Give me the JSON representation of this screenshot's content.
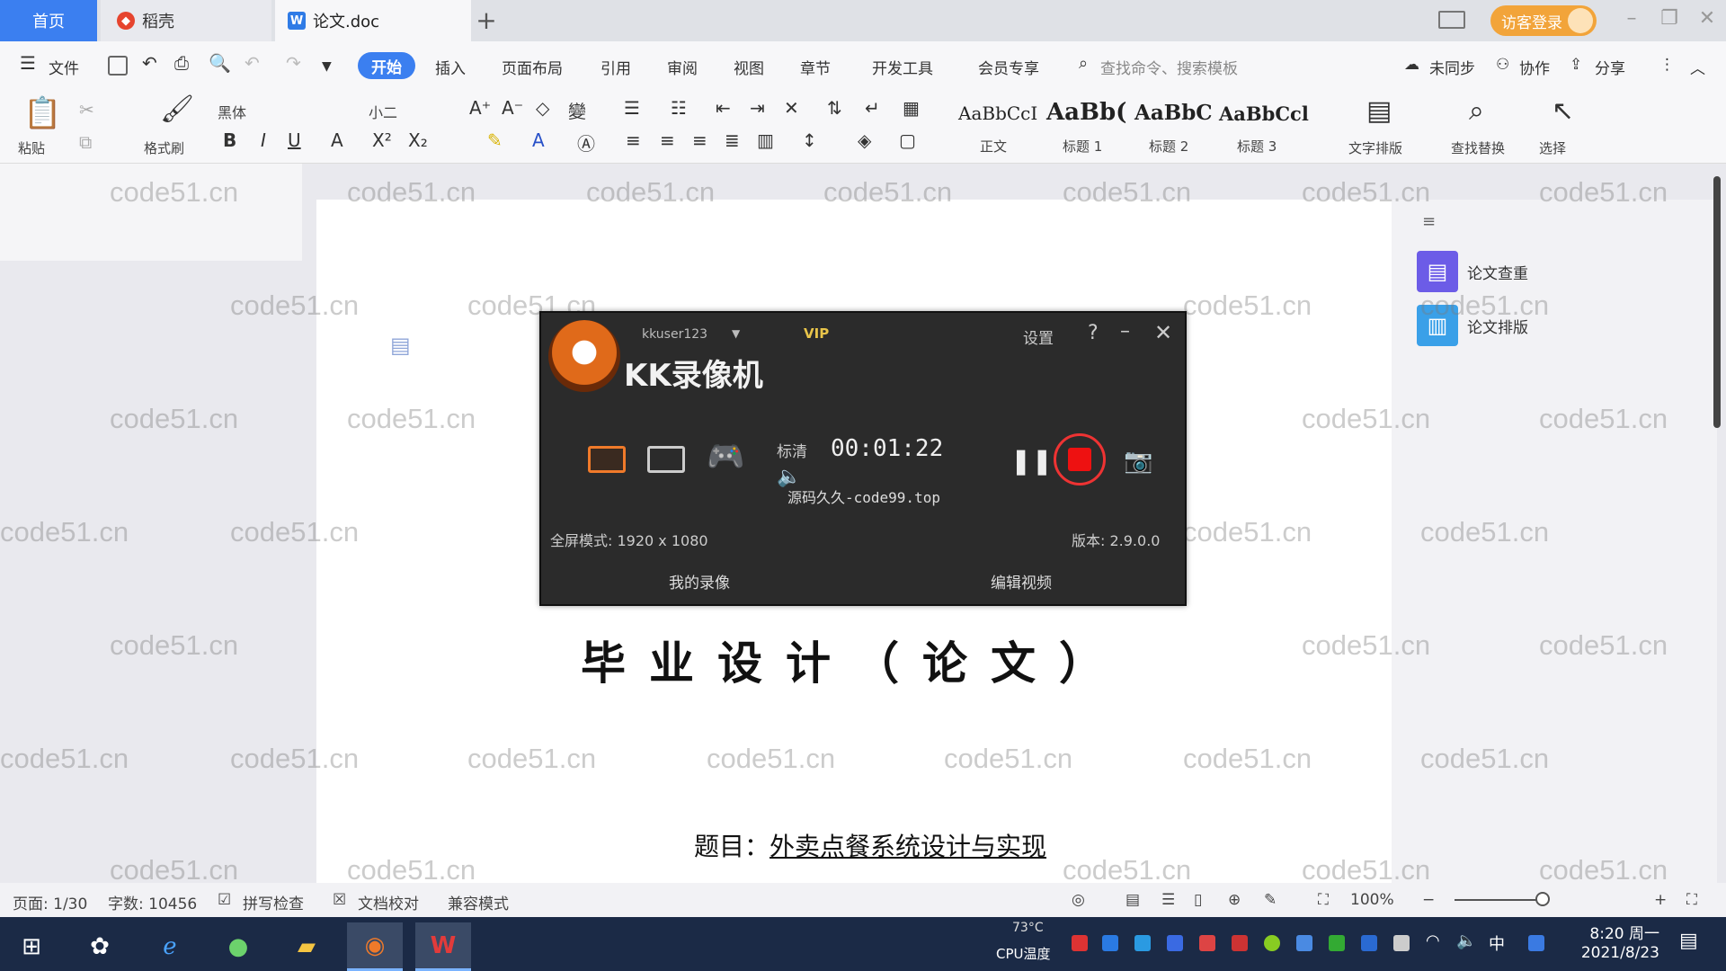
{
  "tabs": {
    "home": "首页",
    "daoke": "稻壳",
    "doc": "论文.doc",
    "add": "+"
  },
  "header": {
    "guest_login": "访客登录"
  },
  "menu": {
    "file": "文件",
    "start": "开始",
    "insert": "插入",
    "page_layout": "页面布局",
    "references": "引用",
    "review": "审阅",
    "view": "视图",
    "chapter": "章节",
    "developer": "开发工具",
    "member": "会员专享",
    "search_placeholder": "查找命令、搜索模板",
    "not_synced": "未同步",
    "collaborate": "协作",
    "share": "分享"
  },
  "ribbon": {
    "paste": "粘贴",
    "format_painter": "格式刷",
    "font_name": "黑体",
    "font_size": "小二",
    "styles": [
      {
        "preview": "AaBbCcI",
        "label": "正文"
      },
      {
        "preview": "AaBb(",
        "label": "标题 1"
      },
      {
        "preview": "AaBbC",
        "label": "标题 2"
      },
      {
        "preview": "AaBbCcl",
        "label": "标题 3"
      }
    ],
    "text_layout": "文字排版",
    "find_replace": "查找替换",
    "select": "选择"
  },
  "right_pane": {
    "items": [
      {
        "label": "论文查重"
      },
      {
        "label": "论文排版"
      }
    ]
  },
  "document": {
    "title": "毕业设计（论文）",
    "topic_label": "题目：",
    "topic_value": "外卖点餐系统设计与实现"
  },
  "watermark_text": "code51.cn",
  "kk_recorder": {
    "app_name": "KK录像机",
    "user": "kkuser123",
    "vip": "VIP",
    "settings": "设置",
    "help": "?",
    "quality": "标清",
    "timer": "00:01:22",
    "source_watermark": "源码久久-code99.top",
    "fullscreen_mode": "全屏模式: 1920 x 1080",
    "version": "版本: 2.9.0.0",
    "my_videos": "我的录像",
    "edit_video": "编辑视频"
  },
  "status": {
    "page": "页面: 1/30",
    "word_count": "字数: 10456",
    "spell_check": "拼写检查",
    "doc_proof": "文档校对",
    "compat_mode": "兼容模式",
    "zoom": "100%"
  },
  "taskbar": {
    "cpu_temp": "73°C",
    "cpu_label": "CPU温度",
    "ime": "中",
    "time": "8:20 周一",
    "date": "2021/8/23"
  }
}
